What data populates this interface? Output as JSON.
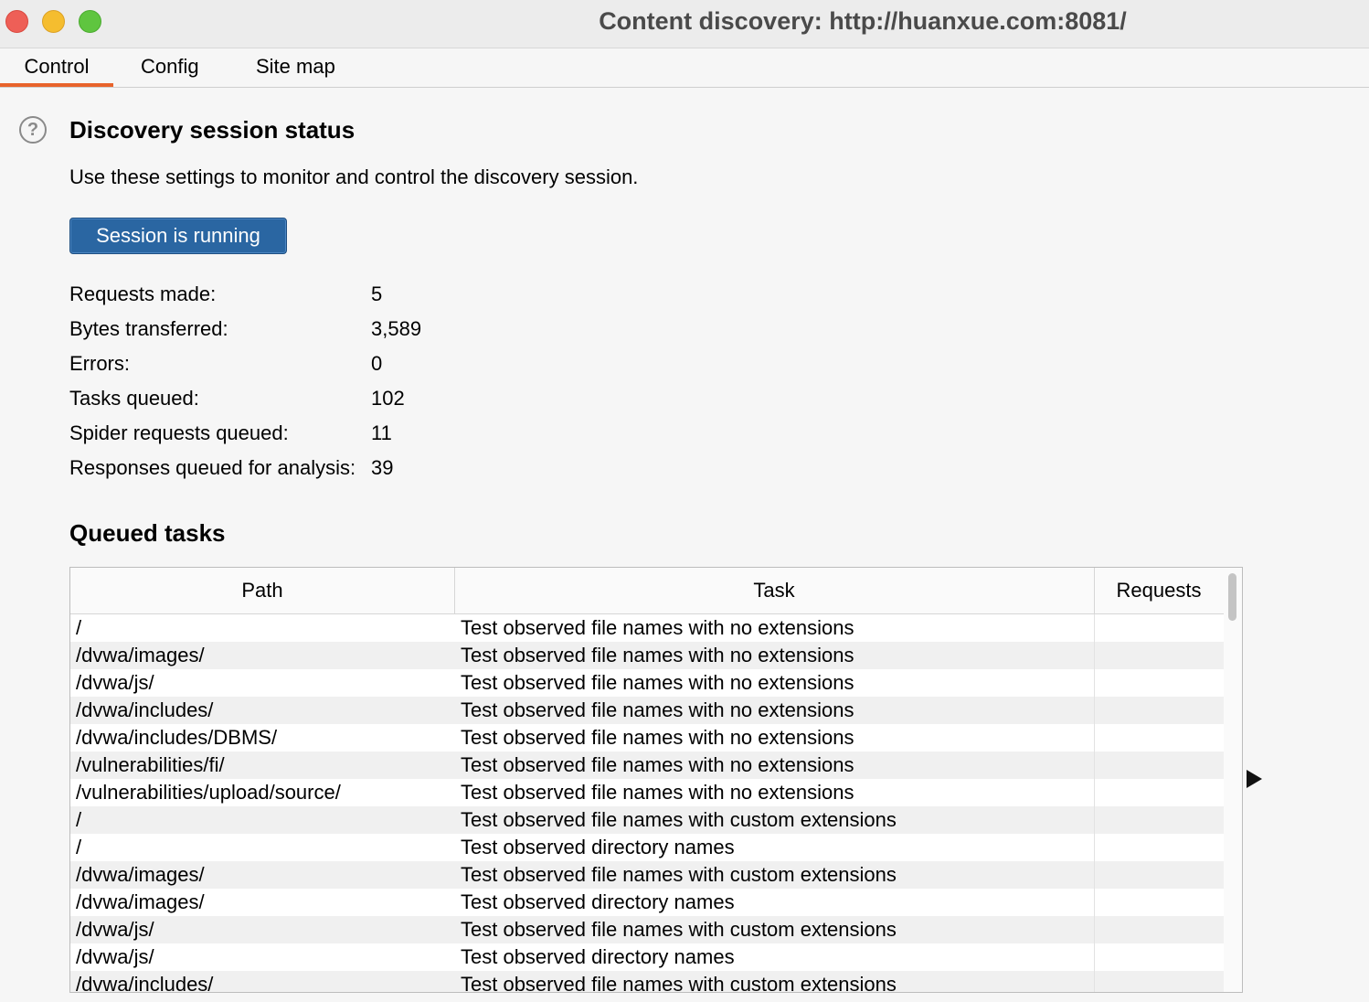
{
  "window": {
    "title": "Content discovery: http://huanxue.com:8081/"
  },
  "tabs": [
    "Control",
    "Config",
    "Site map"
  ],
  "status": {
    "heading": "Discovery session status",
    "description": "Use these settings to monitor and control the discovery session.",
    "button_label": "Session is running",
    "stats": [
      {
        "label": "Requests made:",
        "value": "5"
      },
      {
        "label": "Bytes transferred:",
        "value": "3,589"
      },
      {
        "label": "Errors:",
        "value": "0"
      },
      {
        "label": "Tasks queued:",
        "value": "102"
      },
      {
        "label": "Spider requests queued:",
        "value": "11"
      },
      {
        "label": "Responses queued for analysis:",
        "value": "39"
      }
    ]
  },
  "queued": {
    "heading": "Queued tasks",
    "columns": [
      "Path",
      "Task",
      "Requests"
    ],
    "rows": [
      {
        "path": "/",
        "task": "Test observed file names with no extensions",
        "requests": ""
      },
      {
        "path": "/dvwa/images/",
        "task": "Test observed file names with no extensions",
        "requests": ""
      },
      {
        "path": "/dvwa/js/",
        "task": "Test observed file names with no extensions",
        "requests": ""
      },
      {
        "path": "/dvwa/includes/",
        "task": "Test observed file names with no extensions",
        "requests": ""
      },
      {
        "path": "/dvwa/includes/DBMS/",
        "task": "Test observed file names with no extensions",
        "requests": ""
      },
      {
        "path": "/vulnerabilities/fi/",
        "task": "Test observed file names with no extensions",
        "requests": ""
      },
      {
        "path": "/vulnerabilities/upload/source/",
        "task": "Test observed file names with no extensions",
        "requests": ""
      },
      {
        "path": "/",
        "task": "Test observed file names with custom extensions",
        "requests": ""
      },
      {
        "path": "/",
        "task": "Test observed directory names",
        "requests": ""
      },
      {
        "path": "/dvwa/images/",
        "task": "Test observed file names with custom extensions",
        "requests": ""
      },
      {
        "path": "/dvwa/images/",
        "task": "Test observed directory names",
        "requests": ""
      },
      {
        "path": "/dvwa/js/",
        "task": "Test observed file names with custom extensions",
        "requests": ""
      },
      {
        "path": "/dvwa/js/",
        "task": "Test observed directory names",
        "requests": ""
      },
      {
        "path": "/dvwa/includes/",
        "task": "Test observed file names with custom extensions",
        "requests": ""
      }
    ]
  },
  "icons": {
    "help": "help-circle-icon",
    "expand": "triangle-right-icon"
  },
  "colors": {
    "accent": "#e8632b",
    "button": "#2a66a2"
  }
}
